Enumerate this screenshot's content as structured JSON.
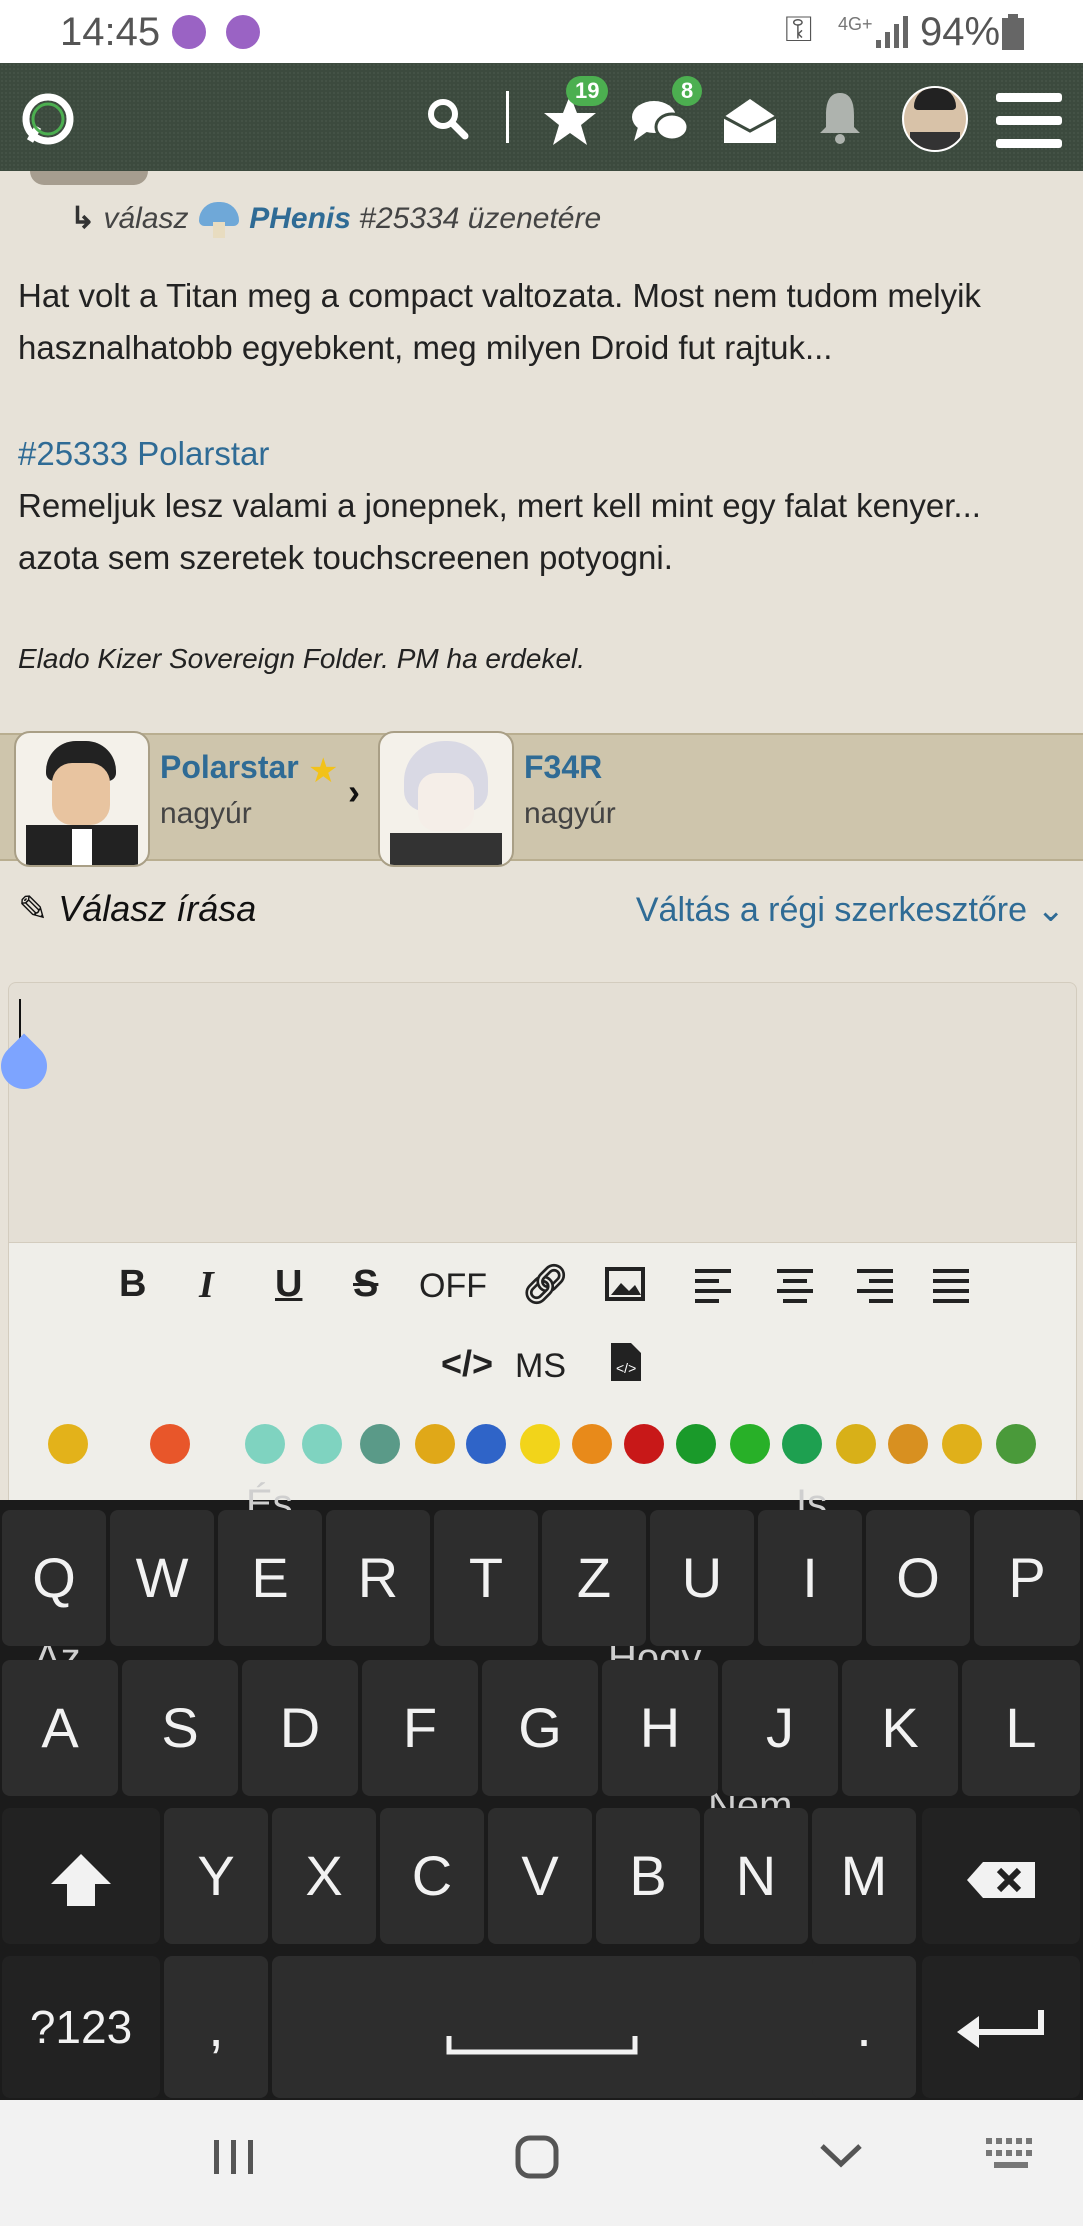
{
  "status_bar": {
    "time": "14:45",
    "network": "4G+",
    "battery": "94%"
  },
  "nav": {
    "stars_badge": "19",
    "chats_badge": "8"
  },
  "post": {
    "reply_prefix": "válasz",
    "reply_user": "PHenis",
    "reply_suffix": "#25334 üzenetére",
    "paragraph1": "Hat volt a Titan meg a compact valtozata. Most nem tudom melyik hasznalhatobb egyebkent, meg milyen Droid fut rajtuk...",
    "quote_ref": "#25333 Polarstar",
    "paragraph2": "Remeljuk lesz valami a jonepnek, mert kell mint egy falat kenyer... azota sem szeretek touchscreenen potyogni.",
    "signature": "Elado Kizer Sovereign Folder. PM ha erdekel."
  },
  "users": [
    {
      "name": "Polarstar",
      "rank": "nagyúr"
    },
    {
      "name": "F34R",
      "rank": "nagyúr"
    }
  ],
  "editor": {
    "title": "Válasz írása",
    "switch_label": "Váltás a régi szerkesztőre",
    "toolbar": {
      "bold": "B",
      "italic": "I",
      "underline": "U",
      "strike": "S",
      "off": "OFF",
      "ms": "MS"
    }
  },
  "keyboard": {
    "row1": [
      "Q",
      "W",
      "E",
      "R",
      "T",
      "Z",
      "U",
      "I",
      "O",
      "P"
    ],
    "row2": [
      "A",
      "S",
      "D",
      "F",
      "G",
      "H",
      "J",
      "K",
      "L"
    ],
    "row3": [
      "Y",
      "X",
      "C",
      "V",
      "B",
      "N",
      "M"
    ],
    "suggestions": {
      "e": "És",
      "i": "Is",
      "a": "Az",
      "h": "Hogy",
      "n": "Nem"
    },
    "sym": "?123",
    "comma": ",",
    "period": "."
  },
  "colors": {
    "nav_bg": "#3c4a3e",
    "link": "#2f6b95",
    "badge": "#4caf50",
    "keyboard_bg": "#1b1b1b"
  }
}
